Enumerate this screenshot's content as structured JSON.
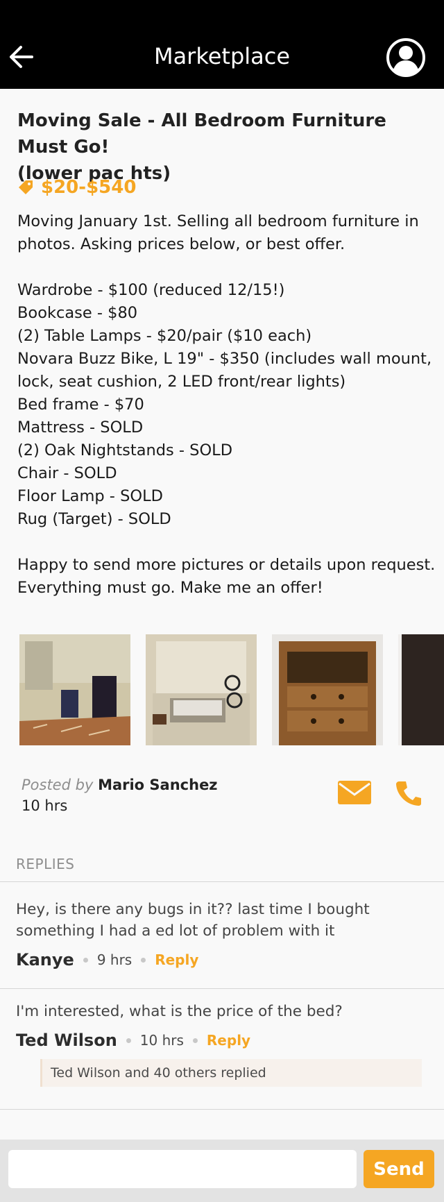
{
  "header": {
    "title": "Marketplace",
    "back_icon": "arrow-left-icon",
    "profile_icon": "user-circle-icon"
  },
  "listing": {
    "title_lines": [
      "Moving Sale - All Bedroom Furniture Must Go!",
      "(lower pac hts)"
    ],
    "price": "$20-$540",
    "price_icon": "tag-icon",
    "description_lines": [
      "Moving January 1st. Selling all bedroom furniture in",
      "photos. Asking prices below, or best offer.",
      "",
      "Wardrobe - $100 (reduced 12/15!)",
      "Bookcase - $80",
      "(2) Table Lamps - $20/pair ($10 each)",
      "Novara Buzz Bike, L 19\" - $350 (includes wall mount,",
      "lock, seat cushion, 2 LED front/rear lights)",
      "Bed frame - $70",
      "Mattress - SOLD",
      "(2) Oak Nightstands - SOLD",
      "Chair - SOLD",
      "Floor Lamp - SOLD",
      "Rug (Target) - SOLD",
      "",
      "Happy to send more pictures or details upon request.",
      "Everything must go. Make me an offer!"
    ]
  },
  "seller": {
    "posted_by_label": "Posted by",
    "name": "Mario Sanchez",
    "time": "10 hrs",
    "mail_icon": "envelope-icon",
    "phone_icon": "phone-icon"
  },
  "replies": {
    "heading": "REPLIES",
    "items": [
      {
        "body_lines": [
          "Hey, is there any bugs in it?? last time I bought",
          "something I had a ed lot of problem with it"
        ],
        "author": "Kanye",
        "time": "9 hrs",
        "reply_label": "Reply"
      },
      {
        "body_lines": [
          "I'm interested, what is the price of the bed?"
        ],
        "author": "Ted Wilson",
        "time": "10 hrs",
        "reply_label": "Reply"
      }
    ],
    "reactions": "Ted Wilson and 40 others replied"
  },
  "composer": {
    "placeholder": "",
    "send_label": "Send"
  },
  "colors": {
    "accent": "#F5A623",
    "text": "#1A1A1A",
    "header_bg": "#000000"
  }
}
